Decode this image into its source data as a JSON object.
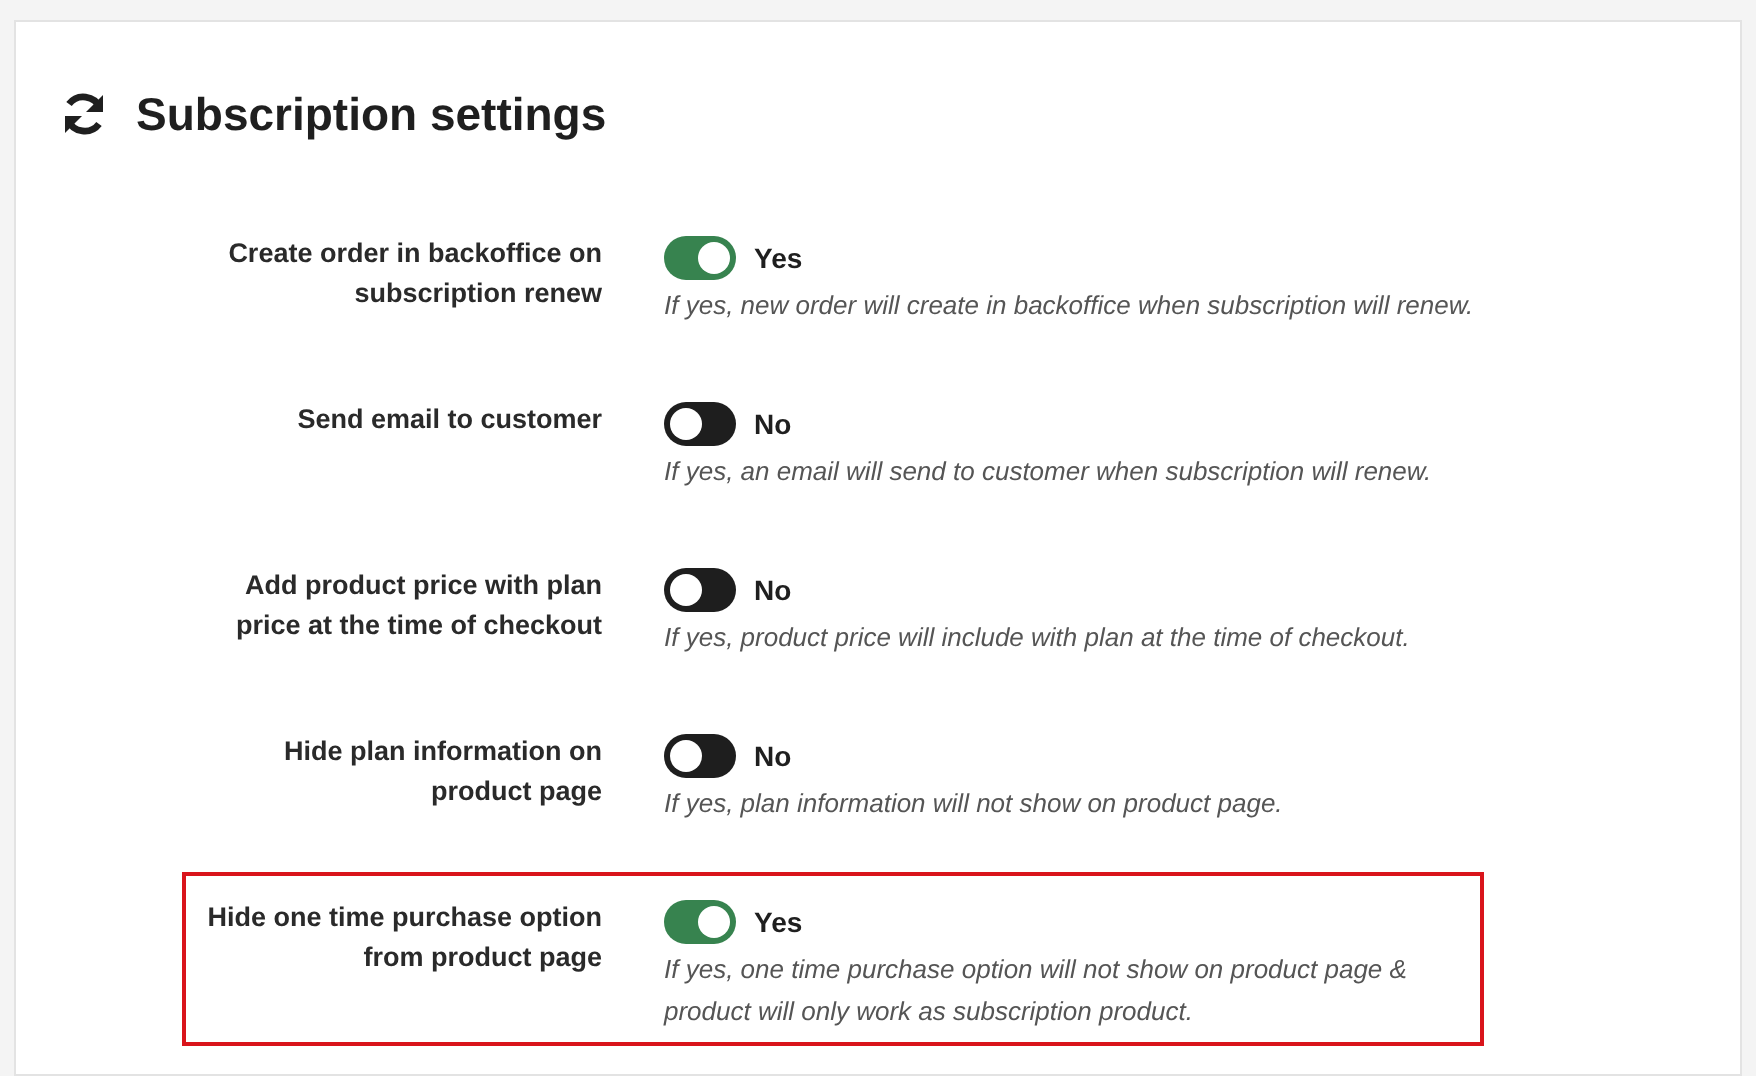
{
  "title": "Subscription settings",
  "settings": [
    {
      "label": "Create order in backoffice on subscription renew",
      "on": true,
      "value": "Yes",
      "help": "If yes, new order will create in backoffice when subscription will renew.",
      "highlighted": false
    },
    {
      "label": "Send email to customer",
      "on": false,
      "value": "No",
      "help": "If yes, an email will send to customer when subscription will renew.",
      "highlighted": false
    },
    {
      "label": "Add product price with plan price at the time of checkout",
      "on": false,
      "value": "No",
      "help": "If yes, product price will include with plan at the time of checkout.",
      "highlighted": false
    },
    {
      "label": "Hide plan information on product page",
      "on": false,
      "value": "No",
      "help": "If yes, plan information will not show on product page.",
      "highlighted": false
    },
    {
      "label": "Hide one time purchase option from product page",
      "on": true,
      "value": "Yes",
      "help": "If yes, one time purchase option will not show on product page & product will only work as subscription product.",
      "highlighted": true
    }
  ]
}
